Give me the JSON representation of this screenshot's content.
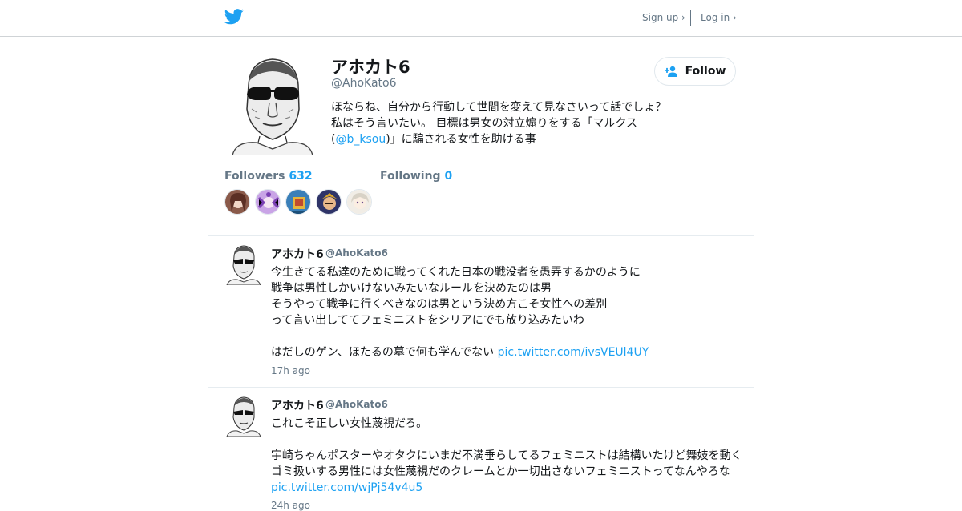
{
  "header": {
    "signup": "Sign up ›",
    "login": "Log in ›"
  },
  "profile": {
    "name": "アホカト6",
    "handle": "@AhoKato6",
    "follow_label": "Follow",
    "bio_pre": "ほならね、自分から行動して世間を変えて見なさいって話でしょ？ 私はそう言いたい。 目標は男女の対立煽りをする「マルクス(",
    "bio_link": "@b_ksou",
    "bio_post": ")」に騙される女性を助ける事",
    "followers_label": "Followers",
    "followers_count": "632",
    "following_label": "Following",
    "following_count": "0"
  },
  "tweets": [
    {
      "name": "アホカト6",
      "handle": "@AhoKato6",
      "text": "今生きてる私達のために戦ってくれた日本の戦没者を愚弄するかのように\n戦争は男性しかいけないみたいなルールを決めたのは男\nそうやって戦争に行くべきなのは男という決め方こそ女性への差別\nって言い出しててフェミニストをシリアにでも放り込みたいわ\n\nはだしのゲン、ほたるの墓で何も学んでない ",
      "link": "pic.twitter.com/ivsVEUl4UY",
      "time": "17h ago"
    },
    {
      "name": "アホカト6",
      "handle": "@AhoKato6",
      "text": "これこそ正しい女性蔑視だろ。\n\n宇崎ちゃんポスターやオタクにいまだ不満垂らしてるフェミニストは結構いたけど舞妓を動く\nゴミ扱いする男性には女性蔑視だのクレームとか一切出さないフェミニストってなんやろな\n",
      "link": "pic.twitter.com/wjPj54v4u5",
      "time": "24h ago"
    }
  ],
  "colors": {
    "accent": "#1da1f2",
    "muted": "#657786",
    "border": "#e6ecf0"
  },
  "icons": [
    "twitter-bird-icon",
    "add-user-icon"
  ]
}
